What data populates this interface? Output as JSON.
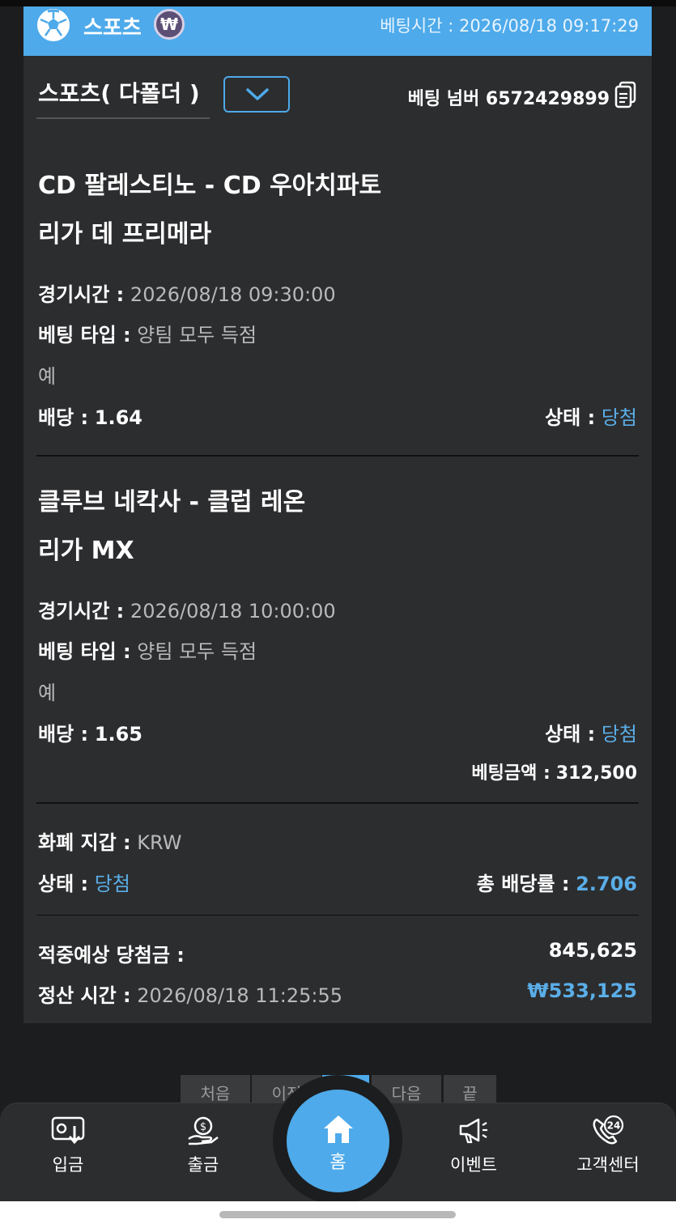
{
  "header": {
    "title": "스포츠",
    "currency_badge": "₩",
    "bet_time_label": "베팅시간 :",
    "bet_time": "2026/08/18 09:17:29"
  },
  "bet_info": {
    "type_title": "스포츠( 다폴더 )",
    "bet_number_label": "베팅 넘버",
    "bet_number": "6572429899"
  },
  "labels": {
    "match_time": "경기시간 :",
    "bet_type": "베팅 타입 :",
    "odds": "배당 :",
    "status": "상태 :",
    "bet_amount": "베팅금액 :",
    "wallet": "화폐 지갑 :",
    "total_odds": "총 배당률 :",
    "expected_win": "적중예상 당첨금 :",
    "settle_time": "정산 시간 :"
  },
  "matches": [
    {
      "teams": "CD 팔레스티노 - CD 우아치파토",
      "league": "리가 데 프리메라",
      "match_time": "2026/08/18 09:30:00",
      "bet_type": "양팀 모두 득점",
      "selection": "예",
      "odds": "1.64",
      "status": "당첨"
    },
    {
      "teams": "클루브 네칵사 - 클럽 레온",
      "league": "리가 MX",
      "match_time": "2026/08/18 10:00:00",
      "bet_type": "양팀 모두 득점",
      "selection": "예",
      "odds": "1.65",
      "status": "당첨"
    }
  ],
  "summary": {
    "bet_amount": "312,500",
    "wallet": "KRW",
    "status": "당첨",
    "total_odds": "2.706",
    "expected_win": "845,625",
    "settle_time": "2026/08/18 11:25:55",
    "payout": "₩533,125"
  },
  "pager": [
    "처음",
    "이전",
    "",
    "다음",
    "끝"
  ],
  "nav": {
    "deposit": "입금",
    "withdraw": "출금",
    "home": "홈",
    "event": "이벤트",
    "support": "고객센터",
    "support_badge": "24"
  },
  "colors": {
    "accent": "#4eaaea",
    "card_bg": "#2c2d2f",
    "page_bg": "#1c1d1f",
    "win_text": "#5aaee8"
  }
}
